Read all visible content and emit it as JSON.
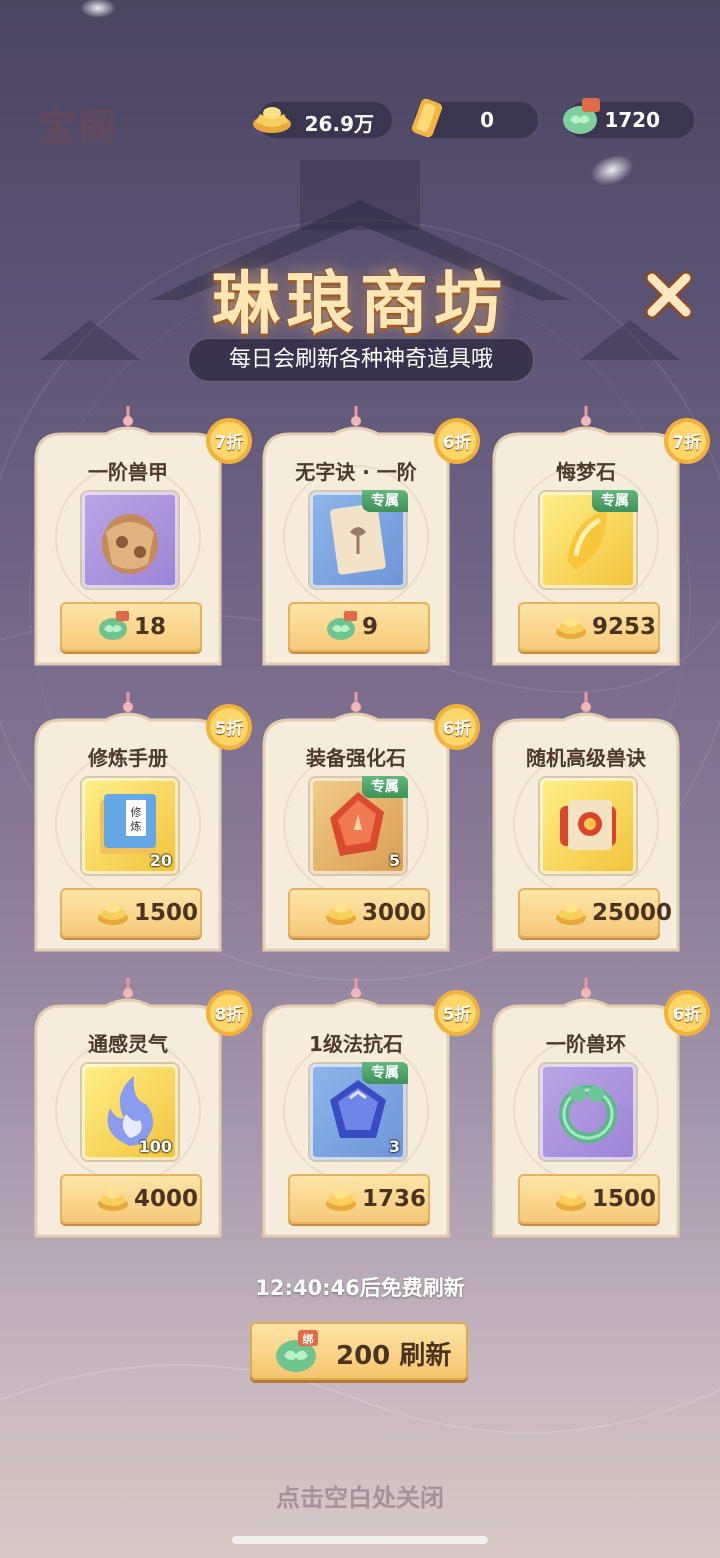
{
  "header": {
    "faded_title": "宝阁",
    "currencies": [
      {
        "icon": "gold-ingot-icon",
        "value": "26.9万"
      },
      {
        "icon": "gold-bar-icon",
        "value": "0"
      },
      {
        "icon": "jade-cloud-bound-icon",
        "value": "1720",
        "badge": "绑"
      }
    ]
  },
  "shop": {
    "title": "琳琅商坊",
    "subtitle": "每日会刷新各种神奇道具哦",
    "items": [
      {
        "name": "一阶兽甲",
        "discount": "7折",
        "price": "18",
        "currency": "jade",
        "qty": "",
        "tag": "",
        "item_icon": "beast-armor-icon",
        "bg": "purple"
      },
      {
        "name": "无字诀 · 一阶",
        "discount": "6折",
        "price": "9",
        "currency": "jade",
        "qty": "",
        "tag": "专属",
        "item_icon": "scroll-icon",
        "bg": "blue"
      },
      {
        "name": "悔梦石",
        "discount": "7折",
        "price": "9253",
        "currency": "gold",
        "qty": "",
        "tag": "专属",
        "item_icon": "dream-stone-icon",
        "bg": "gold"
      },
      {
        "name": "修炼手册",
        "discount": "5折",
        "price": "1500",
        "currency": "gold",
        "qty": "20",
        "tag": "",
        "item_icon": "manual-book-icon",
        "bg": "gold"
      },
      {
        "name": "装备强化石",
        "discount": "6折",
        "price": "3000",
        "currency": "gold",
        "qty": "5",
        "tag": "专属",
        "item_icon": "enhance-stone-icon",
        "bg": "orange"
      },
      {
        "name": "随机高级兽诀",
        "discount": "",
        "price": "25000",
        "currency": "gold",
        "qty": "",
        "tag": "",
        "item_icon": "beast-scroll-icon",
        "bg": "gold"
      },
      {
        "name": "通感灵气",
        "discount": "8折",
        "price": "4000",
        "currency": "gold",
        "qty": "100",
        "tag": "",
        "item_icon": "spirit-flame-icon",
        "bg": "gold"
      },
      {
        "name": "1级法抗石",
        "discount": "5折",
        "price": "1736",
        "currency": "gold",
        "qty": "3",
        "tag": "专属",
        "item_icon": "resist-gem-icon",
        "bg": "blue"
      },
      {
        "name": "一阶兽环",
        "discount": "6折",
        "price": "1500",
        "currency": "gold",
        "qty": "",
        "tag": "",
        "item_icon": "jade-ring-icon",
        "bg": "purple"
      }
    ]
  },
  "footer": {
    "timer_text": "12:40:46后免费刷新",
    "refresh_label": "200 刷新",
    "refresh_badge": "绑",
    "close_hint": "点击空白处关闭"
  }
}
